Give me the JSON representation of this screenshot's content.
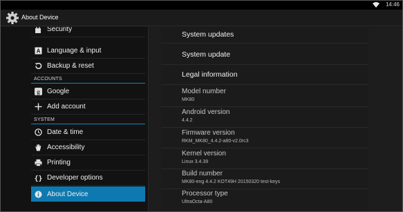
{
  "status_bar": {
    "time": "14:46",
    "wifi_icon": "wifi-icon"
  },
  "action_bar": {
    "title": "About Device",
    "icon": "settings-gear-icon"
  },
  "sidebar": {
    "items": [
      {
        "label": "Security",
        "icon": "lock-icon"
      },
      {
        "label": "Language & input",
        "icon": "keyboard-a-icon"
      },
      {
        "label": "Backup & reset",
        "icon": "backup-restore-icon"
      },
      {
        "section": "ACCOUNTS"
      },
      {
        "label": "Google",
        "icon": "google-g-icon"
      },
      {
        "label": "Add account",
        "icon": "plus-icon"
      },
      {
        "section": "SYSTEM"
      },
      {
        "label": "Date & time",
        "icon": "clock-icon"
      },
      {
        "label": "Accessibility",
        "icon": "hand-icon"
      },
      {
        "label": "Printing",
        "icon": "printer-icon"
      },
      {
        "label": "Developer options",
        "icon": "braces-icon"
      },
      {
        "label": "About Device",
        "icon": "info-icon",
        "selected": true
      }
    ]
  },
  "details": {
    "actions": [
      {
        "label": "System updates"
      },
      {
        "label": "System update"
      },
      {
        "label": "Legal information"
      }
    ],
    "info": [
      {
        "label": "Model number",
        "value": "MK80"
      },
      {
        "label": "Android version",
        "value": "4.4.2"
      },
      {
        "label": "Firmware version",
        "value": "RKM_MK80_4.4.2-a80-v2.0rc3"
      },
      {
        "label": "Kernel version",
        "value": "Linux 3.4.39"
      },
      {
        "label": "Build number",
        "value": "MK80-eng 4.4.2 KOT49H 20150320 test-keys"
      },
      {
        "label": "Processor type",
        "value": "UltraOcta-A80"
      }
    ]
  },
  "colors": {
    "accent": "#0e79b0",
    "section_line": "#0c89c8",
    "background": "#1a1a1a"
  }
}
